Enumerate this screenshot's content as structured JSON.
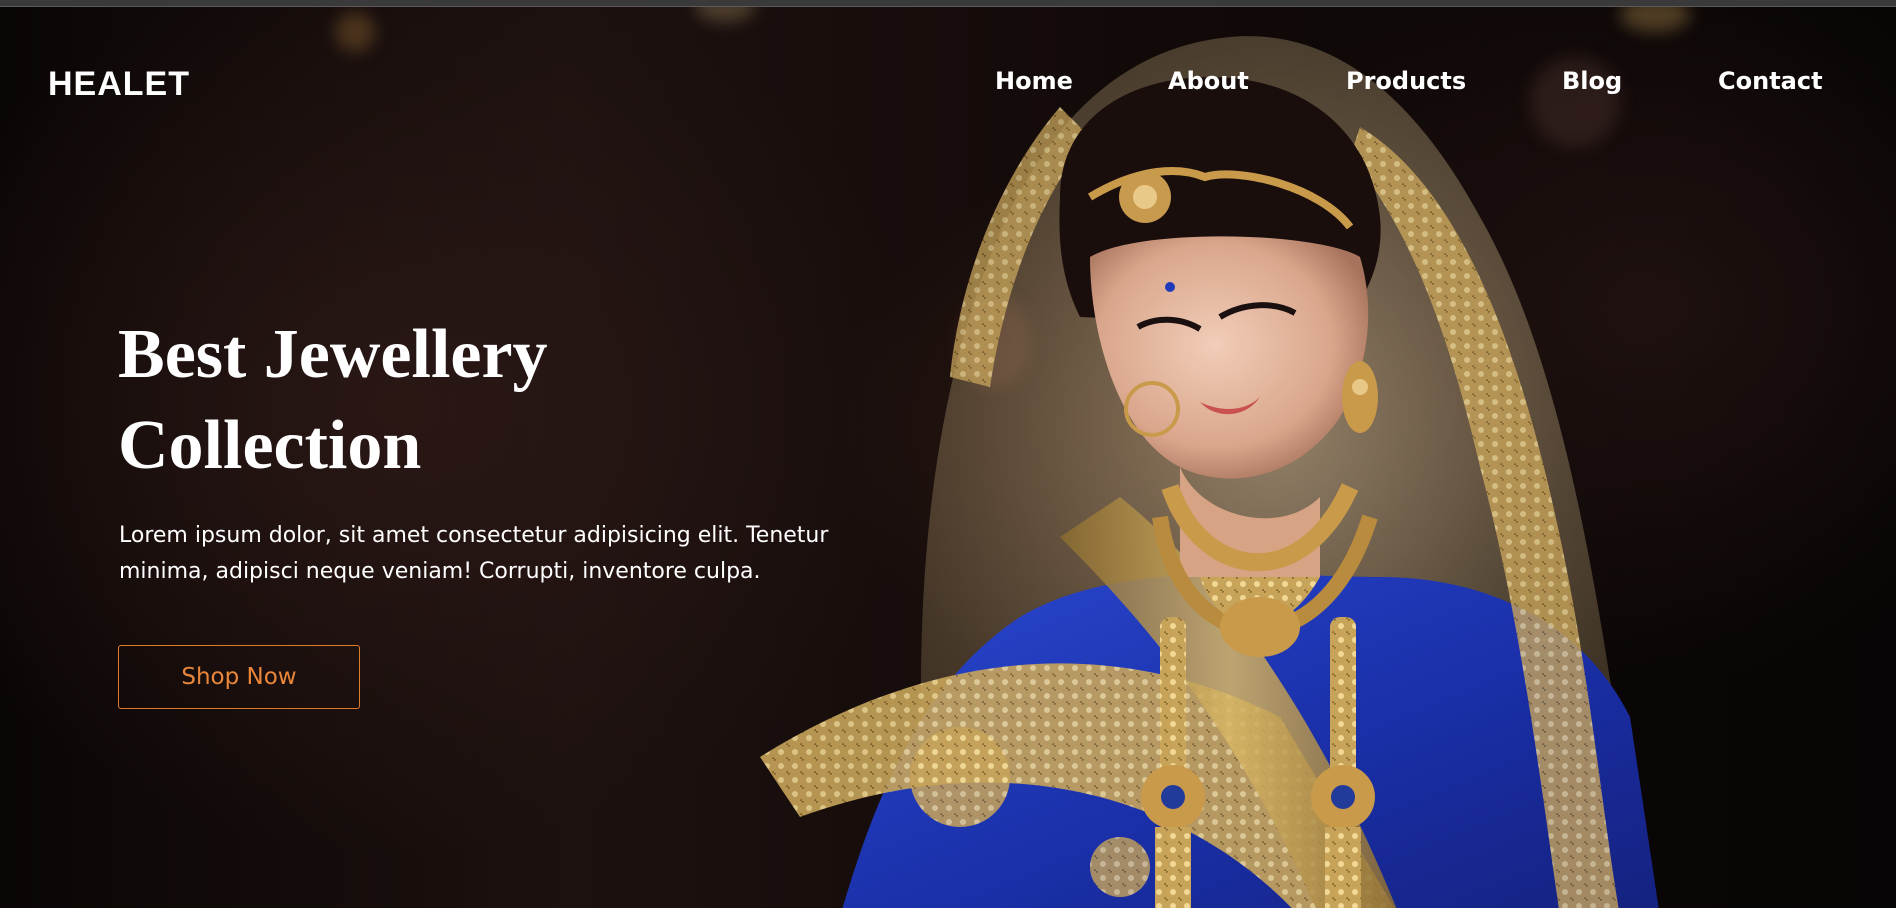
{
  "brand": {
    "logo": "HEALET"
  },
  "nav": {
    "items": [
      {
        "label": "Home"
      },
      {
        "label": "About"
      },
      {
        "label": "Products"
      },
      {
        "label": "Blog"
      },
      {
        "label": "Contact"
      }
    ]
  },
  "hero": {
    "title_line1": "Best Jewellery",
    "title_line2": "Collection",
    "description_line1": "Lorem ipsum dolor, sit amet consectetur adipisicing elit. Tenetur",
    "description_line2": "minima, adipisci neque veniam! Corrupti, inventore culpa.",
    "cta_label": "Shop Now",
    "image_subject": "bride in blue saree with gold jewellery"
  },
  "colors": {
    "accent": "#e9863a",
    "background": "#0b0706",
    "text": "#ffffff",
    "saree_blue": "#1f3bb8",
    "gold": "#c9a352"
  }
}
